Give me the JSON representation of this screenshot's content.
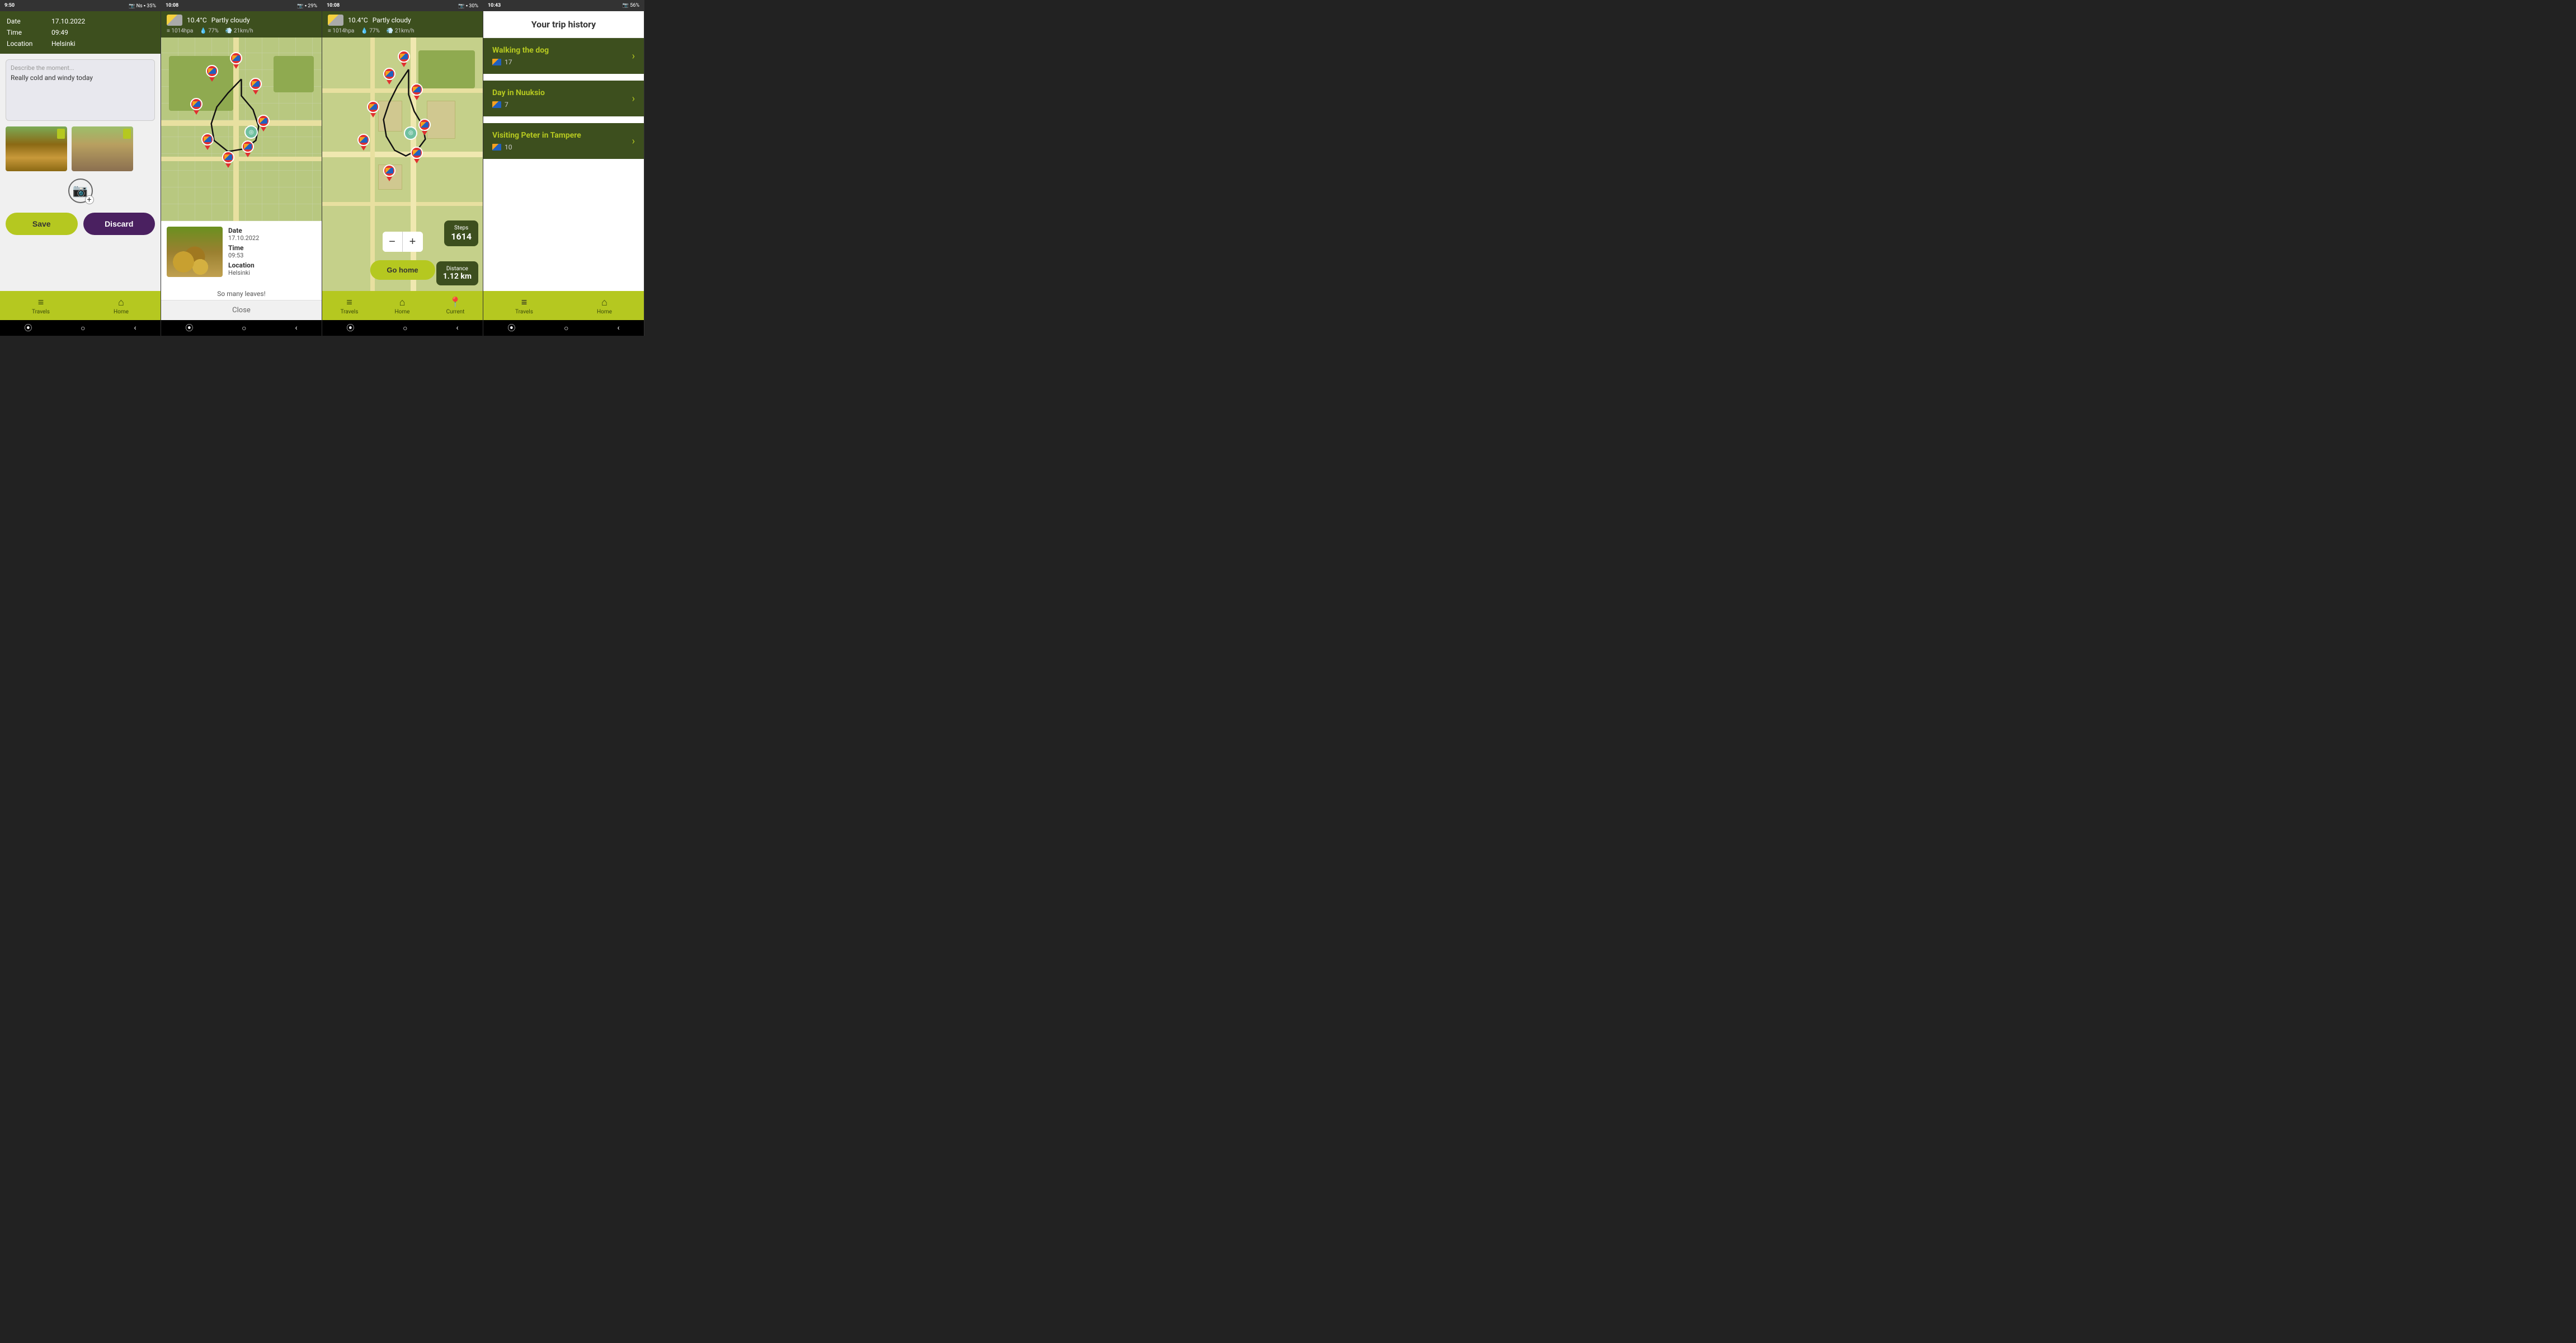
{
  "screen1": {
    "status_time": "9:50",
    "status_icons": "📷 Ns 35%",
    "header": {
      "date_label": "Date",
      "date_value": "17.10.2022",
      "time_label": "Time",
      "time_value": "09:49",
      "location_label": "Location",
      "location_value": "Helsinki"
    },
    "textarea": {
      "placeholder": "Describe the moment...",
      "content": "Really cold and windy today"
    },
    "save_label": "Save",
    "discard_label": "Discard",
    "add_photo_label": "Add photo",
    "nav": {
      "travels": "Travels",
      "home": "Home"
    }
  },
  "screen2": {
    "status_time": "10:08",
    "status_icons": "📷 29%",
    "weather": {
      "temp": "10.4°C",
      "condition": "Partly cloudy",
      "pressure": "1014hpa",
      "humidity": "77%",
      "wind": "21km/h"
    },
    "detail": {
      "date_label": "Date",
      "date_value": "17.10.2022",
      "time_label": "Time",
      "time_value": "09:53",
      "location_label": "Location",
      "location_value": "Helsinki",
      "caption": "So many leaves!"
    },
    "close_label": "Close",
    "nav": {
      "travels": "Travels",
      "home": "Home"
    }
  },
  "screen3": {
    "status_time": "10:08",
    "status_icons": "📷 30%",
    "weather": {
      "temp": "10.4°C",
      "condition": "Partly cloudy",
      "pressure": "1014hpa",
      "humidity": "77%",
      "wind": "21km/h"
    },
    "steps_label": "Steps",
    "steps_value": "1614",
    "distance_label": "Distance",
    "distance_value": "1.12 km",
    "zoom_minus": "−",
    "zoom_plus": "+",
    "go_home_label": "Go home",
    "nav": {
      "travels": "Travels",
      "home": "Home",
      "current": "Current"
    }
  },
  "screen4": {
    "status_time": "10:43",
    "status_icons": "📷 56%",
    "title": "Your trip history",
    "trips": [
      {
        "title": "Walking the dog",
        "photo_count": "17"
      },
      {
        "title": "Day in Nuuksio",
        "photo_count": "7"
      },
      {
        "title": "Visiting Peter in Tampere",
        "photo_count": "10"
      }
    ],
    "nav": {
      "travels": "Travels",
      "home": "Home"
    }
  }
}
